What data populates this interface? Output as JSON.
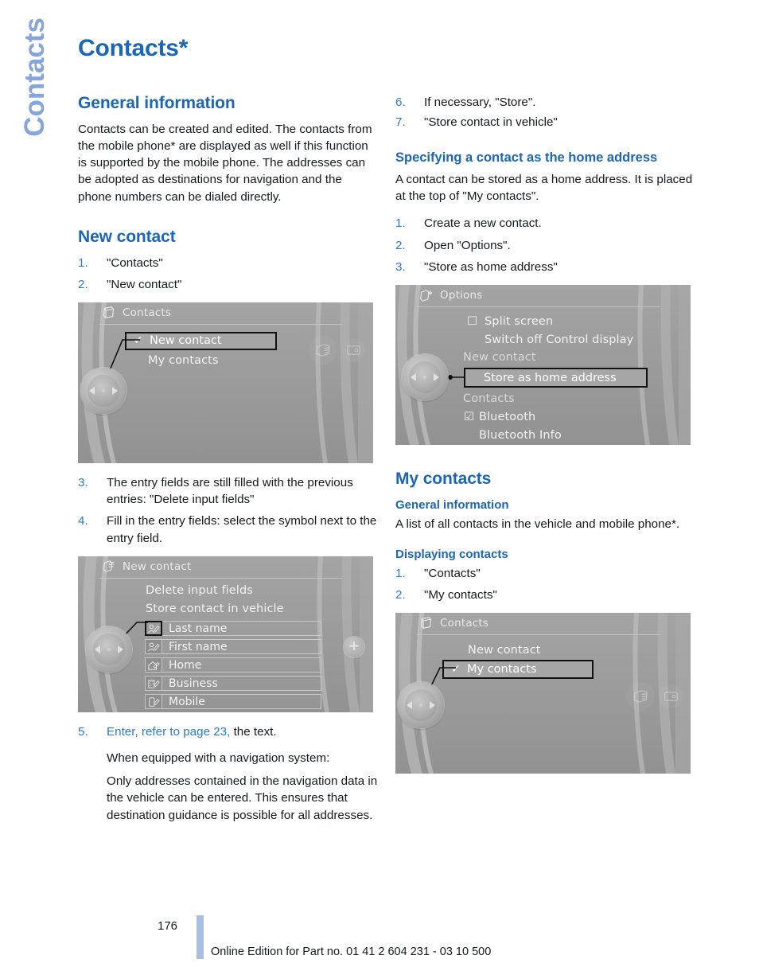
{
  "chapter_tab": "Contacts",
  "page_title": "Contacts*",
  "left_column": {
    "general_information": {
      "heading": "General information",
      "paragraph": "Contacts can be created and edited. The contacts from the mobile phone* are displayed as well if this function is supported by the mobile phone. The addresses can be adopted as destinations for navigation and the phone numbers can be dialed directly."
    },
    "new_contact": {
      "heading": "New contact",
      "steps": [
        {
          "num": "1.",
          "text": "\"Contacts\""
        },
        {
          "num": "2.",
          "text": "\"New contact\""
        }
      ],
      "steps_after": [
        {
          "num": "3.",
          "text": "The entry fields are still filled with the previous entries: \"Delete input fields\""
        },
        {
          "num": "4.",
          "text": "Fill in the entry fields: select the symbol next to the entry field."
        }
      ],
      "step5": {
        "num": "5.",
        "link": "Enter, refer to page 23,",
        "rest": " the text."
      },
      "note1": "When equipped with a navigation system:",
      "note2": "Only addresses contained in the navigation data in the vehicle can be entered. This ensures that destination guidance is possible for all addresses."
    },
    "illustration_contacts": {
      "header_title": "Contacts",
      "header_icon": "contacts-book-icon",
      "items": [
        {
          "label": "New contact",
          "selected": true,
          "check": "✓"
        },
        {
          "label": "My contacts",
          "selected": false,
          "check": ""
        }
      ],
      "right_icons": [
        "multimedia-icon",
        "display-icon"
      ],
      "joystick": "idrive-controller-icon"
    },
    "illustration_new_contact": {
      "header_title": "New contact",
      "header_icon": "new-contact-icon",
      "menu_items": [
        "Delete input fields",
        "Store contact in vehicle"
      ],
      "fields": [
        {
          "label": "Last name",
          "icon": "person-edit-icon",
          "active": true
        },
        {
          "label": "First name",
          "icon": "person-edit-icon",
          "active": false
        },
        {
          "label": "Home",
          "icon": "house-edit-icon",
          "active": false
        },
        {
          "label": "Business",
          "icon": "building-edit-icon",
          "active": false
        },
        {
          "label": "Mobile",
          "icon": "phone-edit-icon",
          "active": false
        }
      ],
      "plus_button": "plus-icon",
      "joystick": "idrive-controller-icon"
    }
  },
  "right_column": {
    "steps_top": [
      {
        "num": "6.",
        "text": "If necessary, \"Store\"."
      },
      {
        "num": "7.",
        "text": "\"Store contact in vehicle\""
      }
    ],
    "home_address": {
      "heading": "Specifying a contact as the home address",
      "paragraph": "A contact can be stored as a home address. It is placed at the top of \"My contacts\".",
      "steps": [
        {
          "num": "1.",
          "text": "Create a new contact."
        },
        {
          "num": "2.",
          "text": "Open \"Options\"."
        },
        {
          "num": "3.",
          "text": "\"Store as home address\""
        }
      ]
    },
    "illustration_options": {
      "header_title": "Options",
      "header_icon": "options-icon",
      "items": [
        {
          "label": "Split screen",
          "box": "☐",
          "indent": 1,
          "selected": false,
          "divider_after": true
        },
        {
          "label": "Switch off Control display",
          "box": "",
          "indent": 2,
          "selected": false,
          "divider_after": false
        },
        {
          "label": "New contact",
          "box": "",
          "indent": 0,
          "selected": false,
          "dim": true
        },
        {
          "label": "Store as home address",
          "box": "",
          "indent": 2,
          "selected": true
        },
        {
          "label": "Contacts",
          "box": "",
          "indent": 0,
          "selected": false,
          "dim": true
        },
        {
          "label": "Bluetooth",
          "box": "☑",
          "indent": 1,
          "selected": false
        },
        {
          "label": "Bluetooth Info",
          "box": "",
          "indent": 2,
          "selected": false
        }
      ],
      "joystick": "idrive-controller-icon"
    },
    "my_contacts": {
      "heading": "My contacts",
      "general_information": {
        "heading": "General information",
        "paragraph": "A list of all contacts in the vehicle and mobile phone*."
      },
      "displaying_contacts": {
        "heading": "Displaying contacts",
        "steps": [
          {
            "num": "1.",
            "text": "\"Contacts\""
          },
          {
            "num": "2.",
            "text": "\"My contacts\""
          }
        ]
      }
    },
    "illustration_my_contacts": {
      "header_title": "Contacts",
      "header_icon": "contacts-book-icon",
      "items": [
        {
          "label": "New contact",
          "selected": false,
          "check": ""
        },
        {
          "label": "My contacts",
          "selected": true,
          "check": "✓"
        }
      ],
      "right_icons": [
        "multimedia-icon",
        "display-icon"
      ],
      "joystick": "idrive-controller-icon"
    }
  },
  "footer": {
    "page_number": "176",
    "note": "Online Edition for Part no. 01 41 2 604 231 - 03 10 500"
  },
  "colors": {
    "heading_blue": "#1a66b8",
    "number_blue": "#2a7bd4",
    "tab_blue": "#86a5da",
    "footer_bar": "#a9bee2",
    "screen_gray": "#9a9a9a"
  }
}
